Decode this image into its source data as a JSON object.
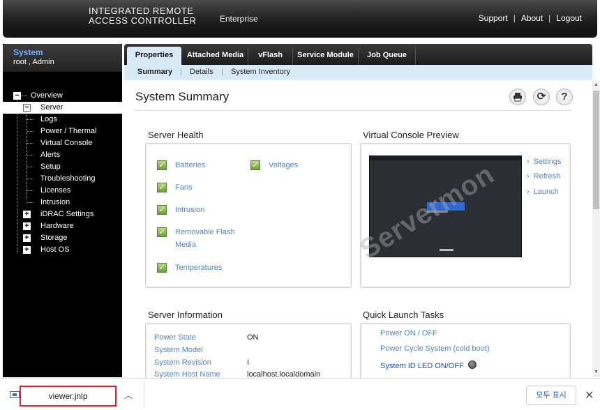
{
  "header": {
    "brand_line1": "INTEGRATED REMOTE",
    "brand_line2": "ACCESS CONTROLLER",
    "edition": "Enterprise",
    "links": [
      "Support",
      "About",
      "Logout"
    ]
  },
  "sidebar": {
    "title": "System",
    "user": "root , Admin",
    "tree": [
      {
        "label": "Overview",
        "expander": "−"
      },
      {
        "label": "Server",
        "expander": "−",
        "selected": true
      },
      {
        "label": "Logs"
      },
      {
        "label": "Power / Thermal"
      },
      {
        "label": "Virtual Console"
      },
      {
        "label": "Alerts"
      },
      {
        "label": "Setup"
      },
      {
        "label": "Troubleshooting"
      },
      {
        "label": "Licenses"
      },
      {
        "label": "Intrusion"
      },
      {
        "label": "iDRAC Settings",
        "expander": "+"
      },
      {
        "label": "Hardware",
        "expander": "+"
      },
      {
        "label": "Storage",
        "expander": "+"
      },
      {
        "label": "Host OS",
        "expander": "+"
      }
    ]
  },
  "tabs": [
    "Properties",
    "Attached Media",
    "vFlash",
    "Service Module",
    "Job Queue"
  ],
  "subtabs": [
    "Summary",
    "Details",
    "System Inventory"
  ],
  "page_title": "System Summary",
  "toolbar_icons": [
    "print-icon",
    "refresh-icon",
    "help-icon"
  ],
  "server_health": {
    "title": "Server Health",
    "items_left": [
      "Batteries",
      "Fans",
      "Intrusion",
      "Removable Flash Media",
      "Temperatures"
    ],
    "items_right": [
      "Voltages"
    ]
  },
  "virtual_console": {
    "title": "Virtual Console Preview",
    "links": [
      "Settings",
      "Refresh",
      "Launch"
    ]
  },
  "server_info": {
    "title": "Server Information",
    "rows": [
      {
        "key": "Power State",
        "value": "ON"
      },
      {
        "key": "System Model",
        "value": ""
      },
      {
        "key": "System Revision",
        "value": "I"
      },
      {
        "key": "System Host Name",
        "value": "localhost.localdomain"
      }
    ]
  },
  "quick_launch": {
    "title": "Quick Launch Tasks",
    "items": [
      "Power ON / OFF",
      "Power Cycle System (cold boot)",
      "System ID LED ON/OFF"
    ]
  },
  "watermark": "Servermon",
  "download_bar": {
    "file": "viewer.jnlp",
    "show_all": "모두 표시"
  },
  "colors": {
    "link": "#4f86c6",
    "tab_active_bg": "#d8e9f8",
    "highlight_border": "#e0242f"
  }
}
